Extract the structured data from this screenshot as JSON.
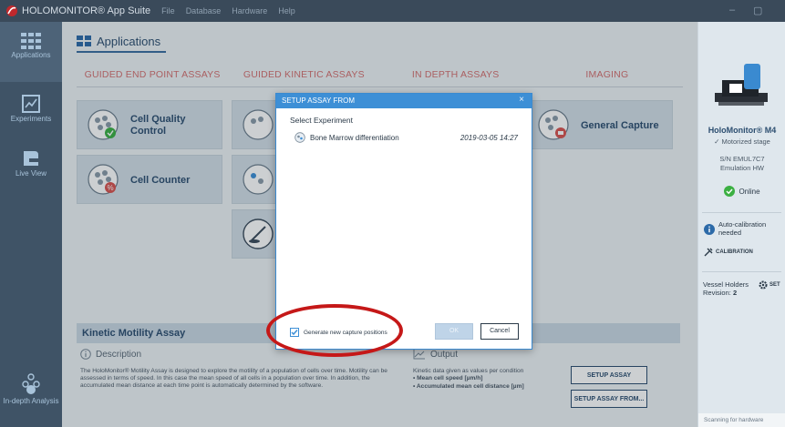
{
  "titlebar": {
    "app_title": "HOLOMONITOR® App Suite",
    "menu": [
      "File",
      "Database",
      "Hardware",
      "Help"
    ],
    "minimize": "–",
    "maximize": "▢"
  },
  "sidebar": {
    "items": [
      {
        "label": "Applications"
      },
      {
        "label": "Experiments"
      },
      {
        "label": "Live View"
      },
      {
        "label": "In-depth Analysis"
      }
    ]
  },
  "main": {
    "tab_label": "Applications",
    "categories": [
      "GUIDED END POINT ASSAYS",
      "GUIDED KINETIC ASSAYS",
      "IN DEPTH ASSAYS",
      "IMAGING"
    ],
    "tiles": {
      "cell_quality": "Cell Quality Control",
      "cell_counter": "Cell Counter",
      "general_capture": "General Capture"
    },
    "assay_title": "Kinetic Motility Assay",
    "description_head": "Description",
    "description_text": "The HoloMonitor® Motility Assay is designed to explore the motility of a population of cells over time. Motility can be assessed in terms of speed. In this case the mean speed of all cells in a population over time. In addition, the accumulated mean distance at each time point is automatically determined by the software.",
    "output_head": "Output",
    "output_intro": "Kinetic data given as values per condition",
    "output_items": [
      "• Mean cell speed [µm/h]",
      "• Accumulated mean cell distance [µm]"
    ],
    "setup_assay": "SETUP ASSAY",
    "setup_assay_from": "SETUP ASSAY FROM..."
  },
  "right_panel": {
    "device_name": "HoloMonitor® M4",
    "stage": "✓ Motorized stage",
    "serial": "S/N EMUL7C7",
    "emulation": "Emulation HW",
    "status": "Online",
    "calib_msg": "Auto-calibration needed",
    "calib_button": "CALIBRATION",
    "vessel_holders": "Vessel Holders",
    "revision_label": "Revision:",
    "revision_value": "2",
    "set_button": "SET",
    "scanning": "Scanning for hardware"
  },
  "dialog": {
    "title": "SETUP ASSAY FROM",
    "close": "×",
    "subtitle": "Select Experiment",
    "experiments": [
      {
        "name": "Bone Marrow differentiation",
        "date": "2019-03-05 14:27"
      }
    ],
    "checkbox_label": "Generate new capture positions",
    "checkbox_checked": true,
    "ok_label": "OK",
    "cancel_label": "Cancel"
  },
  "colors": {
    "accent": "#3d8fd6",
    "highlight": "#c51818",
    "sidebar_bg": "#3f5366",
    "online": "#3cb043"
  }
}
